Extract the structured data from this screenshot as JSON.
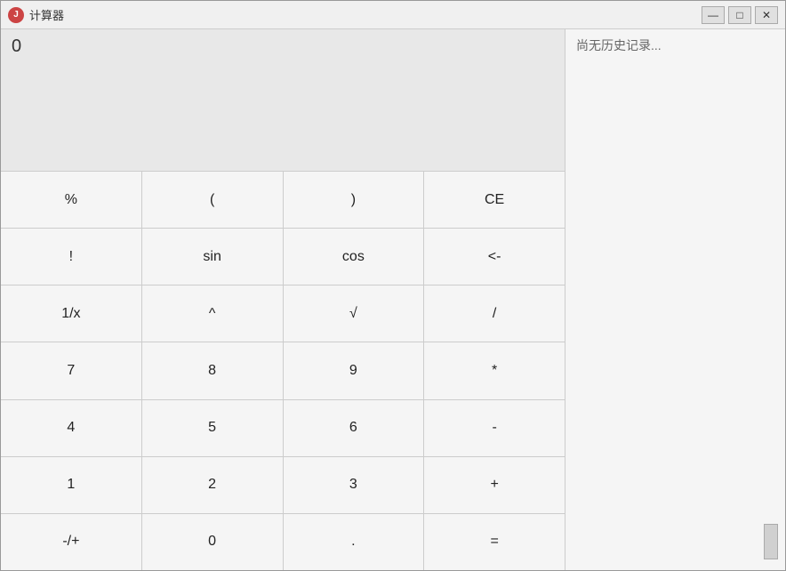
{
  "window": {
    "title": "计算器",
    "icon_label": "J"
  },
  "titlebar": {
    "minimize_label": "—",
    "maximize_label": "□",
    "close_label": "✕"
  },
  "display": {
    "value": "0"
  },
  "history": {
    "empty_text": "尚无历史记录..."
  },
  "buttons": {
    "row1": [
      {
        "label": "%",
        "name": "percent-button"
      },
      {
        "label": "(",
        "name": "open-paren-button"
      },
      {
        "label": ")",
        "name": "close-paren-button"
      },
      {
        "label": "CE",
        "name": "ce-button"
      }
    ],
    "row2": [
      {
        "label": "!",
        "name": "factorial-button"
      },
      {
        "label": "sin",
        "name": "sin-button"
      },
      {
        "label": "cos",
        "name": "cos-button"
      },
      {
        "label": "<-",
        "name": "backspace-button"
      }
    ],
    "row3": [
      {
        "label": "1/x",
        "name": "reciprocal-button"
      },
      {
        "label": "^",
        "name": "power-button"
      },
      {
        "label": "√",
        "name": "sqrt-button"
      },
      {
        "label": "/",
        "name": "divide-button"
      }
    ],
    "row4": [
      {
        "label": "7",
        "name": "seven-button"
      },
      {
        "label": "8",
        "name": "eight-button"
      },
      {
        "label": "9",
        "name": "nine-button"
      },
      {
        "label": "*",
        "name": "multiply-button"
      }
    ],
    "row5": [
      {
        "label": "4",
        "name": "four-button"
      },
      {
        "label": "5",
        "name": "five-button"
      },
      {
        "label": "6",
        "name": "six-button"
      },
      {
        "label": "-",
        "name": "subtract-button"
      }
    ],
    "row6": [
      {
        "label": "1",
        "name": "one-button"
      },
      {
        "label": "2",
        "name": "two-button"
      },
      {
        "label": "3",
        "name": "three-button"
      },
      {
        "label": "+",
        "name": "add-button"
      }
    ],
    "row7": [
      {
        "label": "-/+",
        "name": "negate-button"
      },
      {
        "label": "0",
        "name": "zero-button"
      },
      {
        "label": ".",
        "name": "decimal-button"
      },
      {
        "label": "=",
        "name": "equals-button"
      }
    ]
  }
}
